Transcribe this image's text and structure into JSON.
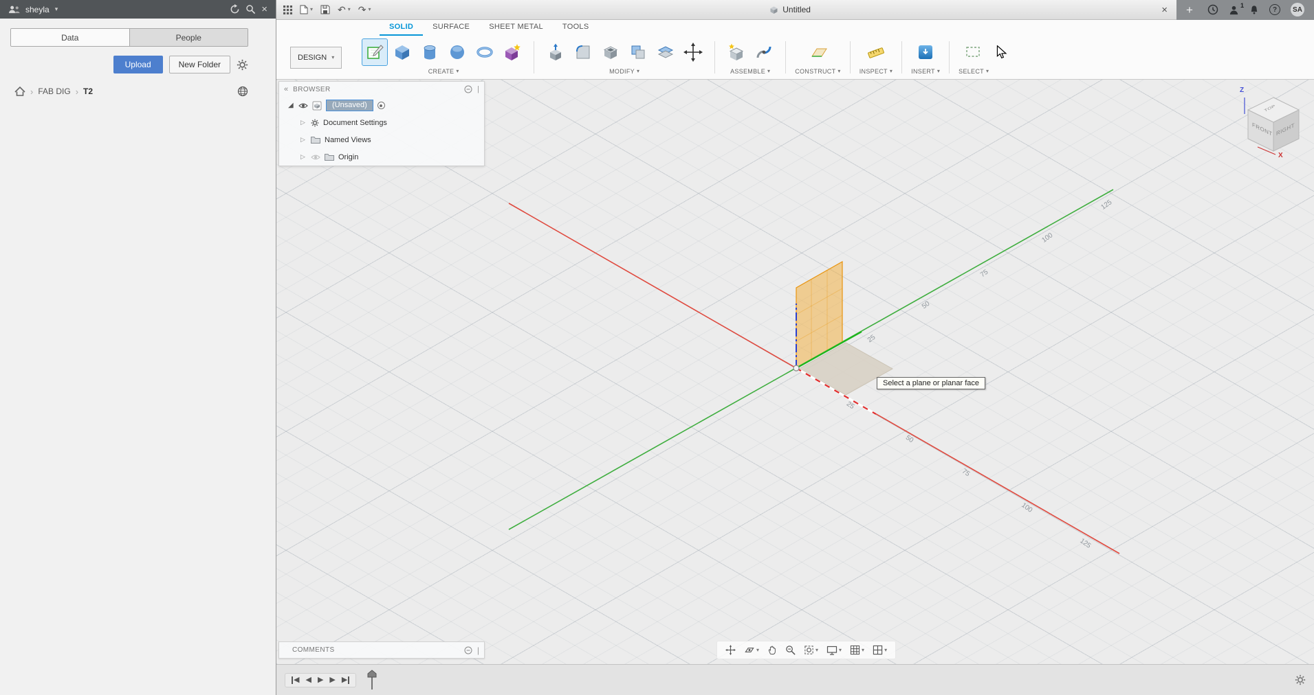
{
  "glyphs": {
    "chevron_down": "▾",
    "breadcrumb_sep": "›",
    "collapse_left": "«",
    "grip": "|",
    "tree_collapsed": "▷",
    "tree_expanded": "◢",
    "plus": "+",
    "close": "×",
    "undo": "↶",
    "redo": "↷",
    "help": "?",
    "play": "▶",
    "step_back": "◀"
  },
  "data_panel": {
    "user": "sheyla",
    "tabs": {
      "data": "Data",
      "people": "People"
    },
    "upload": "Upload",
    "new_folder": "New Folder",
    "breadcrumb": {
      "root": "FAB DIG",
      "current": "T2"
    }
  },
  "titlebar": {
    "title": "Untitled",
    "collaborators_count": "1",
    "avatar_initials": "SA"
  },
  "ribbon": {
    "environment": "DESIGN",
    "tabs": {
      "solid": "SOLID",
      "surface": "SURFACE",
      "sheet_metal": "SHEET METAL",
      "tools": "TOOLS"
    },
    "groups": {
      "create": "CREATE",
      "modify": "MODIFY",
      "assemble": "ASSEMBLE",
      "construct": "CONSTRUCT",
      "inspect": "INSPECT",
      "insert": "INSERT",
      "select": "SELECT"
    }
  },
  "browser": {
    "title": "BROWSER",
    "root_label": "(Unsaved)",
    "items": [
      "Document Settings",
      "Named Views",
      "Origin"
    ]
  },
  "comments": {
    "title": "COMMENTS"
  },
  "viewport": {
    "tooltip": "Select a plane or planar face",
    "grid_labels": [
      "25",
      "50",
      "75",
      "100",
      "125"
    ],
    "viewcube": {
      "top": "TOP",
      "front": "FRONT",
      "right": "RIGHT",
      "z_axis": "Z",
      "x_axis": "X"
    }
  },
  "colors": {
    "accent_blue": "#0696d7",
    "upload_button_blue": "#4d7fce",
    "axis_x_red": "#e04a3f",
    "axis_y_green": "#3fae3f",
    "axis_z_blue": "#2b3fd0",
    "sketch_plane_orange": "#f5a623",
    "selection_blue": "#4a90d9",
    "titlebar_dark_strip": "#8a8d90",
    "data_panel_header": "#515558"
  }
}
